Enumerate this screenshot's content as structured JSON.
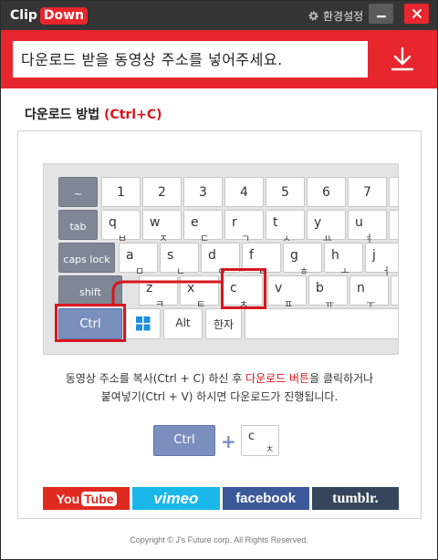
{
  "app": {
    "logo_part1": "Clip",
    "logo_part2": "Down",
    "settings_label": "환경설정"
  },
  "url_bar": {
    "placeholder": "다운로드 받을 동영상 주소를 넣어주세요."
  },
  "howto": {
    "title": "다운로드 방법",
    "shortcut": "(Ctrl+C)"
  },
  "keyboard": {
    "row1": [
      "~",
      "1",
      "2",
      "3",
      "4",
      "5",
      "6",
      "7"
    ],
    "row2_label": "tab",
    "row2": [
      [
        "q",
        "ㅂ"
      ],
      [
        "w",
        "ㅈ"
      ],
      [
        "e",
        "ㄷ"
      ],
      [
        "r",
        "ㄱ"
      ],
      [
        "t",
        "ㅅ"
      ],
      [
        "y",
        "ㅛ"
      ],
      [
        "u",
        "ㅕ"
      ]
    ],
    "row3_label": "caps lock",
    "row3": [
      [
        "a",
        "ㅁ"
      ],
      [
        "s",
        "ㄴ"
      ],
      [
        "d",
        "ㅇ"
      ],
      [
        "f",
        "ㄹ"
      ],
      [
        "g",
        "ㅎ"
      ],
      [
        "h",
        "ㅗ"
      ],
      [
        "j",
        "ㅓ"
      ]
    ],
    "row4_label": "shift",
    "row4": [
      [
        "z",
        "ㅋ"
      ],
      [
        "x",
        "ㅌ"
      ],
      [
        "c",
        "ㅊ"
      ],
      [
        "v",
        "ㅍ"
      ],
      [
        "b",
        "ㅠ"
      ],
      [
        "n",
        "ㅜ"
      ]
    ],
    "ctrl_label": "Ctrl",
    "alt_label": "Alt",
    "hanja_label": "한자"
  },
  "instructions": {
    "line1_a": "동영상 주소를 복사(Ctrl + C) 하신 후 ",
    "line1_red": "다운로드 버튼",
    "line1_b": "을 클릭하거나",
    "line2": "붙여넣기(Ctrl + V) 하시면 다운로드가 진행됩니다."
  },
  "combo": {
    "ctrl_label": "Ctrl",
    "plus": "+",
    "c_main": "c",
    "c_sub": "ㅊ"
  },
  "logos": {
    "youtube_you": "You",
    "youtube_tube": "Tube",
    "vimeo": "vimeo",
    "facebook": "facebook",
    "tumblr": "tumblr."
  },
  "footer": {
    "copyright": "Copyright © J's Future corp. All Rights Reserved."
  },
  "colors": {
    "brand_red": "#e8262d",
    "titlebar": "#353535",
    "key_dark": "#7f8797",
    "key_blue": "#7b8fbf"
  }
}
